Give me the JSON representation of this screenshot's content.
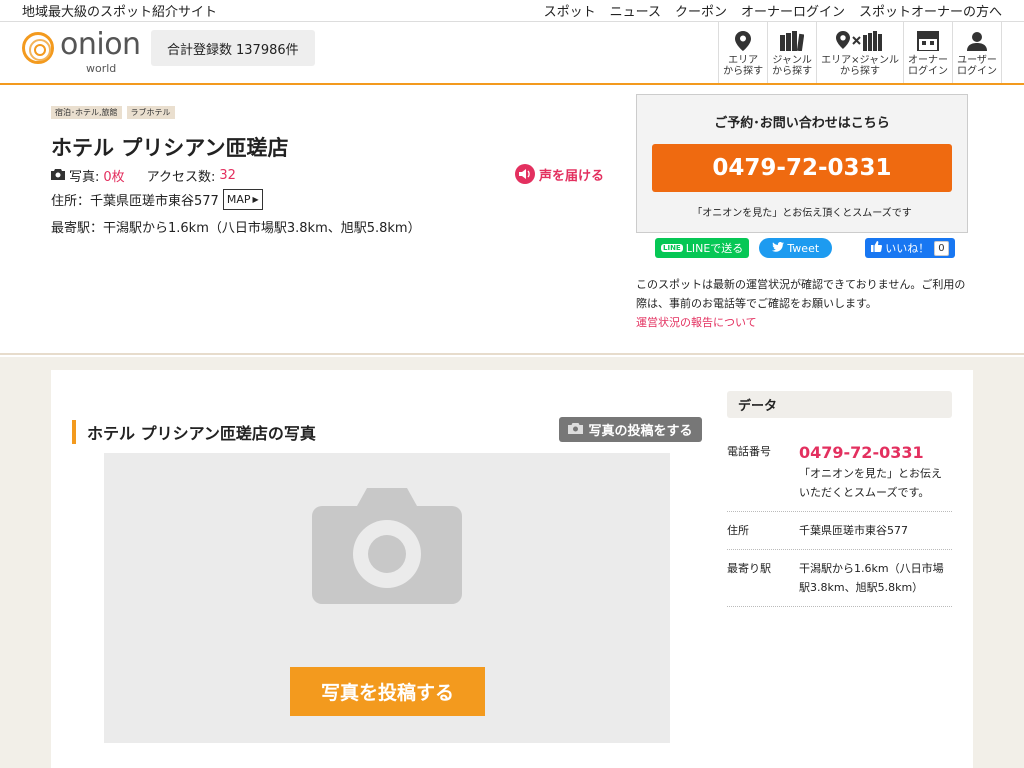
{
  "topbar": {
    "tagline": "地域最大級のスポット紹介サイト",
    "links": [
      "スポット",
      "ニュース",
      "クーポン",
      "オーナーログイン",
      "スポットオーナーの方へ"
    ]
  },
  "header": {
    "logo_text": "onion",
    "logo_sub": "world",
    "count_label": "合計登録数",
    "count_value": "137986件",
    "nav": [
      {
        "icon": "map-pin-icon",
        "line1": "エリア",
        "line2": "から探す"
      },
      {
        "icon": "books-icon",
        "line1": "ジャンル",
        "line2": "から探す"
      },
      {
        "icon": "pin-x-books-icon",
        "line1": "エリア×ジャンル",
        "line2": "から探す"
      },
      {
        "icon": "shop-icon",
        "line1": "オーナー",
        "line2": "ログイン"
      },
      {
        "icon": "user-icon",
        "line1": "ユーザー",
        "line2": "ログイン"
      }
    ]
  },
  "spot": {
    "tags": [
      "宿泊･ホテル,旅館",
      "ラブホテル"
    ],
    "title": "ホテル プリシアン匝瑳店",
    "photo_label": "写真:",
    "photo_count": "0枚",
    "access_label": "アクセス数:",
    "access_count": "32",
    "voice_label": "声を届ける",
    "address": "住所：千葉県匝瑳市東谷577",
    "map_label": "MAP",
    "station": "最寄駅：干潟駅から1.6km（八日市場駅3.8km、旭駅5.8km）"
  },
  "contact": {
    "title": "ご予約･お問い合わせはこちら",
    "tel": "0479-72-0331",
    "note": "「オニオンを見た」とお伝え頂くとスムーズです"
  },
  "social": {
    "line": "LINEで送る",
    "tweet": "Tweet",
    "like": "いいね！",
    "like_count": "0"
  },
  "notice": {
    "text": "このスポットは最新の運営状況が確認できておりません。ご利用の際は、事前のお電話等でご確認をお願いします。",
    "link": "運営状況の報告について"
  },
  "photos": {
    "heading": "ホテル プリシアン匝瑳店の写真",
    "post_small": "写真の投稿をする",
    "post_big": "写真を投稿する"
  },
  "data": {
    "heading": "データ",
    "tel_key": "電話番号",
    "tel_value": "0479-72-0331",
    "tel_note": "「オニオンを見た」とお伝えいただくとスムーズです。",
    "addr_key": "住所",
    "addr_value": "千葉県匝瑳市東谷577",
    "station_key": "最寄り駅",
    "station_value": "干潟駅から1.6km（八日市場駅3.8km、旭駅5.8km）"
  },
  "colors": {
    "accent_orange": "#f39a1e",
    "tel_orange": "#ef6a10",
    "pink": "#e3305f"
  }
}
